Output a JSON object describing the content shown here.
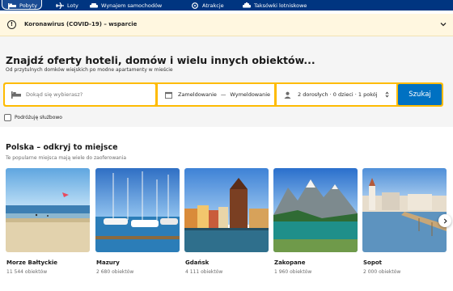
{
  "nav": {
    "items": [
      {
        "label": "Pobyty",
        "icon": "bed-icon"
      },
      {
        "label": "Loty",
        "icon": "plane-icon"
      },
      {
        "label": "Wynajem samochodów",
        "icon": "car-icon"
      },
      {
        "label": "Atrakcje",
        "icon": "attractions-icon"
      },
      {
        "label": "Taksówki lotniskowe",
        "icon": "taxi-icon"
      }
    ]
  },
  "covid_banner": {
    "text": "Koronawirus (COVID-19) – wsparcie",
    "icon": "info-icon"
  },
  "hero": {
    "title": "Znajdź oferty hoteli, domów i wielu innych obiektów...",
    "subtitle": "Od przytulnych domków wiejskich po modne apartamenty w mieście"
  },
  "search": {
    "destination_placeholder": "Dokąd się wybierasz?",
    "checkin_label": "Zameldowanie",
    "separator": "—",
    "checkout_label": "Wymeldowanie",
    "guests_summary": "2 dorosłych · 0 dzieci · 1 pokój",
    "button_label": "Szukaj"
  },
  "business_travel": {
    "label": "Podróżuję służbowo",
    "checked": false
  },
  "section": {
    "title": "Polska – odkryj to miejsce",
    "subtitle": "Te popularne miejsca mają wiele do zaoferowania"
  },
  "destinations": [
    {
      "name": "Morze Bałtyckie",
      "count": "11 544 obiektów"
    },
    {
      "name": "Mazury",
      "count": "2 680 obiektów"
    },
    {
      "name": "Gdańsk",
      "count": "4 111 obiektów"
    },
    {
      "name": "Zakopane",
      "count": "1 960 obiektów"
    },
    {
      "name": "Sopot",
      "count": "2 000 obiektów"
    }
  ],
  "colors": {
    "brand_blue": "#003580",
    "search_yellow": "#febb02",
    "button_blue": "#0071c2",
    "banner_bg": "#fff7e0"
  }
}
